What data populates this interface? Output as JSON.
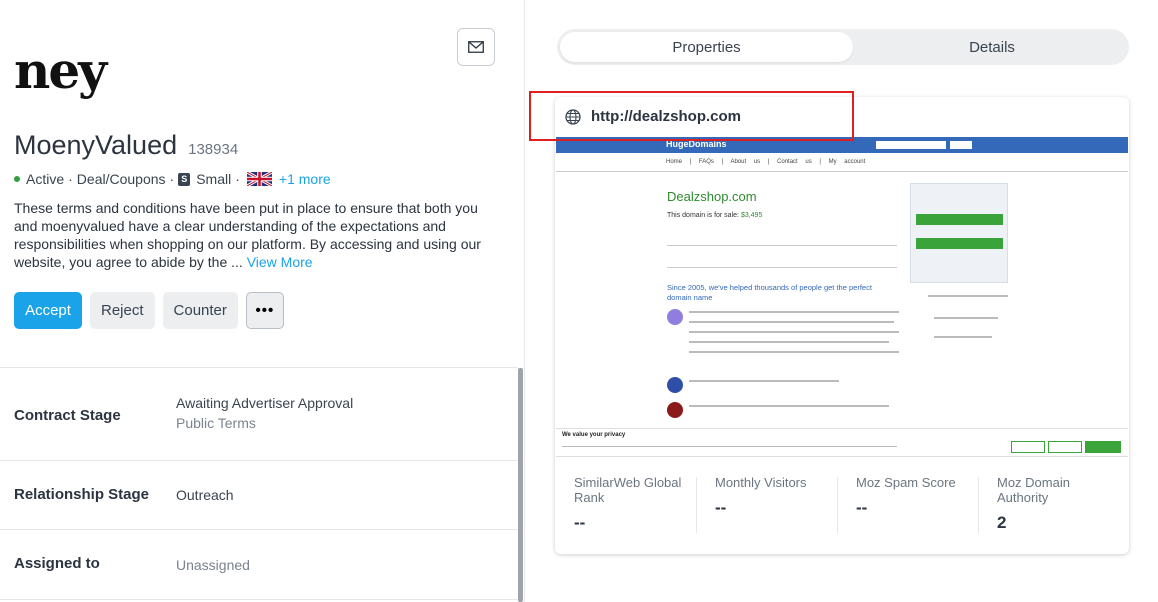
{
  "logo_text": "ney",
  "profile": {
    "name": "MoenyValued",
    "id": "138934",
    "status": "Active",
    "category": "Deal/Coupons",
    "size_badge": "S",
    "size": "Small",
    "more_languages": "+1 more",
    "description": "These terms and conditions have been put in place to ensure that both you and moenyvalued have a clear understanding of the expectations and responsibilities when shopping on our platform. By accessing and using our website, you agree to abide by the ...",
    "view_more": "View More"
  },
  "actions": {
    "accept": "Accept",
    "reject": "Reject",
    "counter": "Counter",
    "more": "•••"
  },
  "details": {
    "contract_stage_label": "Contract Stage",
    "contract_stage_value": "Awaiting Advertiser Approval",
    "contract_stage_sub": "Public Terms",
    "relationship_stage_label": "Relationship Stage",
    "relationship_stage_value": "Outreach",
    "assigned_label": "Assigned to",
    "assigned_value": "Unassigned"
  },
  "tabs": {
    "properties": "Properties",
    "details": "Details"
  },
  "property": {
    "url": "http://dealzshop.com",
    "preview": {
      "brand": "HugeDomains",
      "nav": "Home | FAQs | About us | Contact us | My account",
      "domain_title": "Dealzshop.com",
      "for_sale_text": "This domain is for sale:",
      "price": "$3,495",
      "heading": "Since 2005, we've helped thousands of people get the perfect domain name",
      "cookie_title": "We value your privacy"
    }
  },
  "stats": [
    {
      "label": "SimilarWeb Global Rank",
      "value": "--"
    },
    {
      "label": "Monthly Visitors",
      "value": "--"
    },
    {
      "label": "Moz Spam Score",
      "value": "--"
    },
    {
      "label": "Moz Domain Authority",
      "value": "2"
    }
  ],
  "colors": {
    "accent": "#1aa3e8",
    "active_dot": "#2ea043",
    "highlight": "#e02020"
  }
}
